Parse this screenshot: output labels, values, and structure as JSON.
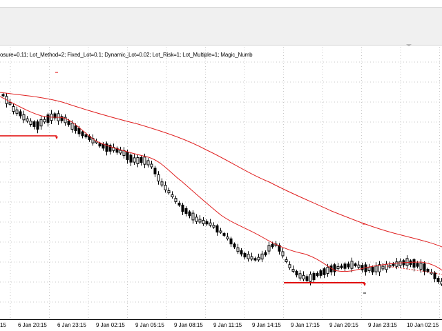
{
  "toolbar": {},
  "chart": {
    "ea_parameters_text": "osure=0.11; Lot_Method=2; Fixed_Lot=0.1; Dynamic_Lot=0.02; Lot_Risk=1; Lot_Multiple=1; Magic_Numb",
    "background_color": "#ffffff",
    "grid_color": "#c8c8c8",
    "candle_color": "#000000",
    "ma_color": "#e02020",
    "trade_line_color": "#e00000"
  },
  "time_axis": {
    "labels": [
      "15",
      "6 Jan 20:15",
      "6 Jan 23:15",
      "9 Jan 02:15",
      "9 Jan 05:15",
      "9 Jan 08:15",
      "9 Jan 11:15",
      "9 Jan 14:15",
      "9 Jan 17:15",
      "9 Jan 20:15",
      "9 Jan 23:15",
      "10 Jan 02:15"
    ]
  }
}
